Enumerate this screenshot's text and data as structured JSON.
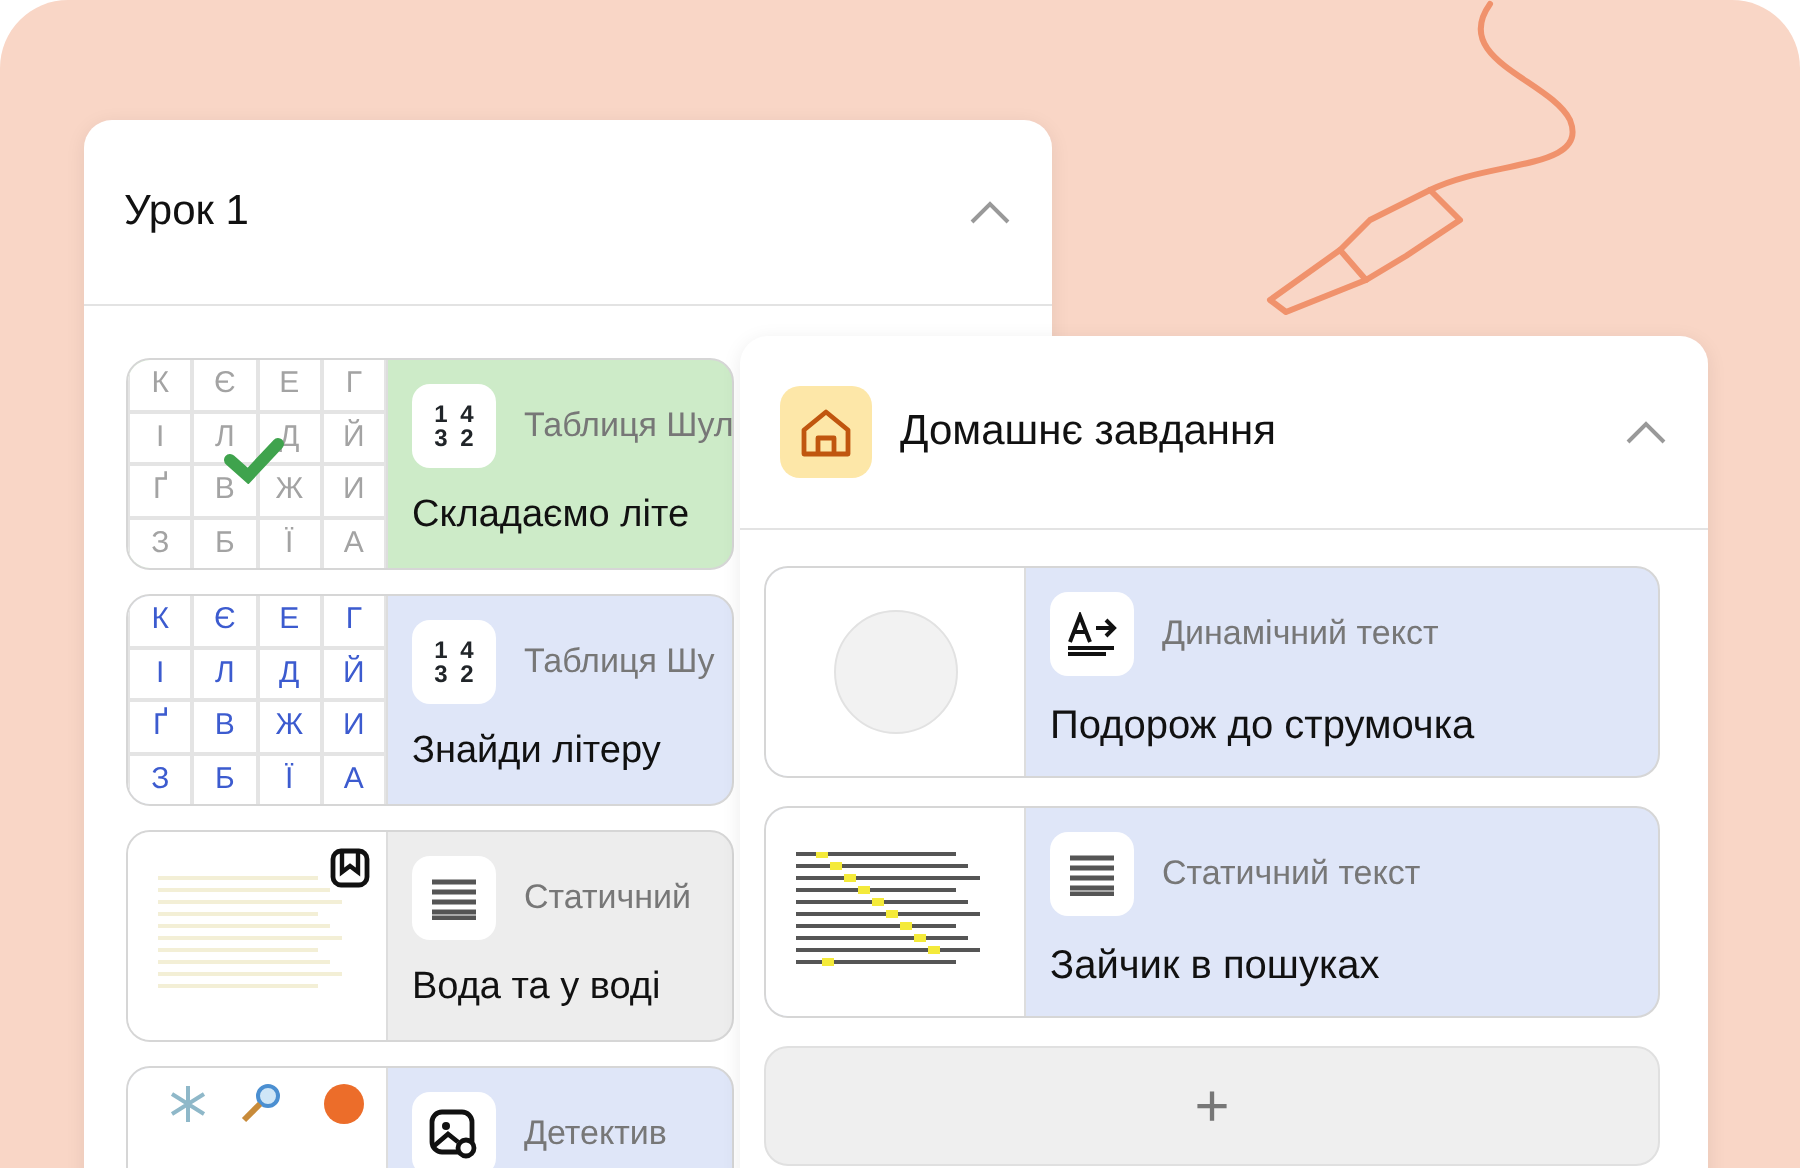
{
  "lesson_card": {
    "title": "Урок 1",
    "expanded": true,
    "items": [
      {
        "preview": {
          "kind": "grid",
          "completed": true,
          "letters": [
            "К",
            "Є",
            "Е",
            "Г",
            "І",
            "Л",
            "Д",
            "Й",
            "Ґ",
            "В",
            "Ж",
            "И",
            "З",
            "Б",
            "Ї",
            "А"
          ]
        },
        "kind": "table",
        "icon_text": [
          "1",
          "4",
          "3",
          "2"
        ],
        "type_label": "Таблиця Шул",
        "title": "Складаємо літе",
        "color": "#cdebc8"
      },
      {
        "preview": {
          "kind": "grid",
          "completed": false,
          "letters": [
            "К",
            "Є",
            "Е",
            "Г",
            "І",
            "Л",
            "Д",
            "Й",
            "Ґ",
            "В",
            "Ж",
            "И",
            "З",
            "Б",
            "Ї",
            "А"
          ]
        },
        "kind": "table",
        "icon_text": [
          "1",
          "4",
          "3",
          "2"
        ],
        "type_label": "Таблиця Шу",
        "title": "Знайди літеру",
        "color": "#dfe6f8"
      },
      {
        "preview": {
          "kind": "text",
          "bookmarked": true
        },
        "kind": "static",
        "type_label": "Статичний",
        "title": "Вода та у воді",
        "color": "#ededed"
      },
      {
        "preview": {
          "kind": "pictures"
        },
        "kind": "detective",
        "type_label": "Детектив",
        "color": "#dfe6f8"
      }
    ]
  },
  "homework_card": {
    "title": "Домашнє завдання",
    "expanded": true,
    "items": [
      {
        "preview": {
          "kind": "circle"
        },
        "kind": "dynamic",
        "type_label": "Динамічний текст",
        "title": "Подорож до струмочка",
        "color": "#dfe6f8"
      },
      {
        "preview": {
          "kind": "highlighted"
        },
        "kind": "static",
        "type_label": "Статичний текст",
        "title": "Зайчик в пошуках",
        "color": "#dfe6f8"
      }
    ],
    "add_button": {
      "label": "+"
    }
  }
}
